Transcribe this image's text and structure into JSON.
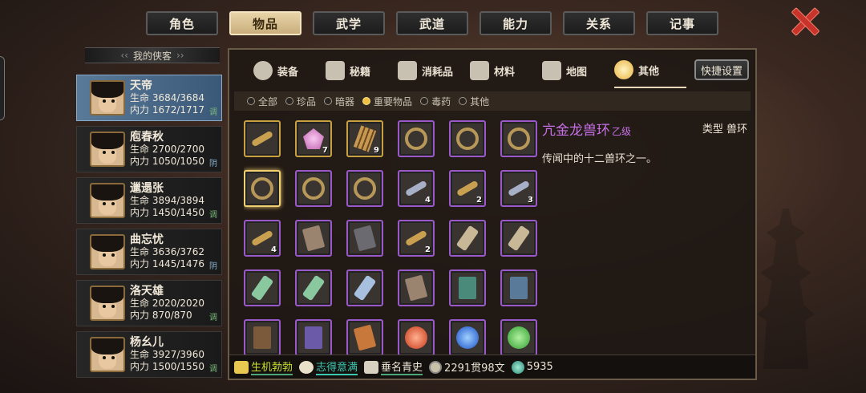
{
  "top_tabs": [
    "角色",
    "物品",
    "武学",
    "武道",
    "能力",
    "关系",
    "记事"
  ],
  "active_top_tab": "物品",
  "roster": {
    "title": "我的侠客",
    "characters": [
      {
        "name": "天帝",
        "hp_label": "生命",
        "hp": "3684/3684",
        "mp_label": "内力",
        "mp": "1672/1717",
        "tag": "调",
        "selected": true
      },
      {
        "name": "庖春秋",
        "hp_label": "生命",
        "hp": "2700/2700",
        "mp_label": "内力",
        "mp": "1050/1050",
        "tag": "阴"
      },
      {
        "name": "邋遢张",
        "hp_label": "生命",
        "hp": "3894/3894",
        "mp_label": "内力",
        "mp": "1450/1450",
        "tag": "调"
      },
      {
        "name": "曲忘忧",
        "hp_label": "生命",
        "hp": "3636/3762",
        "mp_label": "内力",
        "mp": "1445/1476",
        "tag": "阴"
      },
      {
        "name": "洛天雄",
        "hp_label": "生命",
        "hp": "2020/2020",
        "mp_label": "内力",
        "mp": "870/870",
        "tag": "调"
      },
      {
        "name": "杨幺儿",
        "hp_label": "生命",
        "hp": "3927/3960",
        "mp_label": "内力",
        "mp": "1500/1550",
        "tag": "调"
      }
    ]
  },
  "category_tabs": [
    {
      "label": "装备",
      "icon": "armor-icon"
    },
    {
      "label": "秘籍",
      "icon": "book-icon"
    },
    {
      "label": "消耗品",
      "icon": "potion-icon"
    },
    {
      "label": "材料",
      "icon": "herb-icon"
    },
    {
      "label": "地图",
      "icon": "map-icon"
    },
    {
      "label": "其他",
      "icon": "lightbulb-icon"
    }
  ],
  "active_category": "其他",
  "quick_settings": "快捷设置",
  "filters": [
    {
      "label": "全部",
      "on": false
    },
    {
      "label": "珍品",
      "on": false
    },
    {
      "label": "暗器",
      "on": false
    },
    {
      "label": "重要物品",
      "on": true
    },
    {
      "label": "毒药",
      "on": false
    },
    {
      "label": "其他",
      "on": false
    }
  ],
  "items": [
    {
      "icon": "key",
      "rarity": "gold",
      "count": ""
    },
    {
      "icon": "gem",
      "rarity": "gold",
      "count": "7"
    },
    {
      "icon": "sticks",
      "rarity": "gold",
      "count": "9"
    },
    {
      "icon": "ring",
      "rarity": "purple",
      "count": ""
    },
    {
      "icon": "ring",
      "rarity": "purple",
      "count": ""
    },
    {
      "icon": "ring",
      "rarity": "purple",
      "count": ""
    },
    {
      "icon": "ring",
      "rarity": "gold",
      "count": "",
      "selected": true
    },
    {
      "icon": "ring",
      "rarity": "purple",
      "count": ""
    },
    {
      "icon": "ring",
      "rarity": "purple",
      "count": ""
    },
    {
      "icon": "key silver",
      "rarity": "purple",
      "count": "4"
    },
    {
      "icon": "key",
      "rarity": "purple",
      "count": "2"
    },
    {
      "icon": "key silver",
      "rarity": "purple",
      "count": "3"
    },
    {
      "icon": "key",
      "rarity": "purple",
      "count": "4"
    },
    {
      "icon": "plate",
      "rarity": "purple",
      "count": ""
    },
    {
      "icon": "plate dark",
      "rarity": "purple",
      "count": ""
    },
    {
      "icon": "key",
      "rarity": "purple",
      "count": "2"
    },
    {
      "icon": "scroll",
      "rarity": "purple",
      "count": ""
    },
    {
      "icon": "scroll",
      "rarity": "purple",
      "count": ""
    },
    {
      "icon": "scroll green",
      "rarity": "purple",
      "count": ""
    },
    {
      "icon": "scroll green",
      "rarity": "purple",
      "count": ""
    },
    {
      "icon": "scroll blue",
      "rarity": "purple",
      "count": ""
    },
    {
      "icon": "plate",
      "rarity": "purple",
      "count": ""
    },
    {
      "icon": "book green",
      "rarity": "purple",
      "count": ""
    },
    {
      "icon": "book",
      "rarity": "purple",
      "count": ""
    },
    {
      "icon": "book brown",
      "rarity": "purple",
      "count": ""
    },
    {
      "icon": "book purple",
      "rarity": "purple",
      "count": ""
    },
    {
      "icon": "plate orange",
      "rarity": "purple",
      "count": ""
    },
    {
      "icon": "orb red",
      "rarity": "purple",
      "count": ""
    },
    {
      "icon": "orb blue",
      "rarity": "purple",
      "count": ""
    },
    {
      "icon": "orb green",
      "rarity": "purple",
      "count": ""
    }
  ],
  "detail": {
    "name": "亢金龙兽环",
    "grade": "乙级",
    "type_label": "类型",
    "type_value": "兽环",
    "description": "传闻中的十二兽环之一。"
  },
  "status": {
    "vitality": "生机勃勃",
    "mood": "志得意满",
    "fame": "垂名青史",
    "money": "2291贯98文",
    "jade": "5935"
  },
  "colors": {
    "accent_purple": "#c870e8",
    "active_tab": "#e8d4a8",
    "close": "#c8342a"
  }
}
